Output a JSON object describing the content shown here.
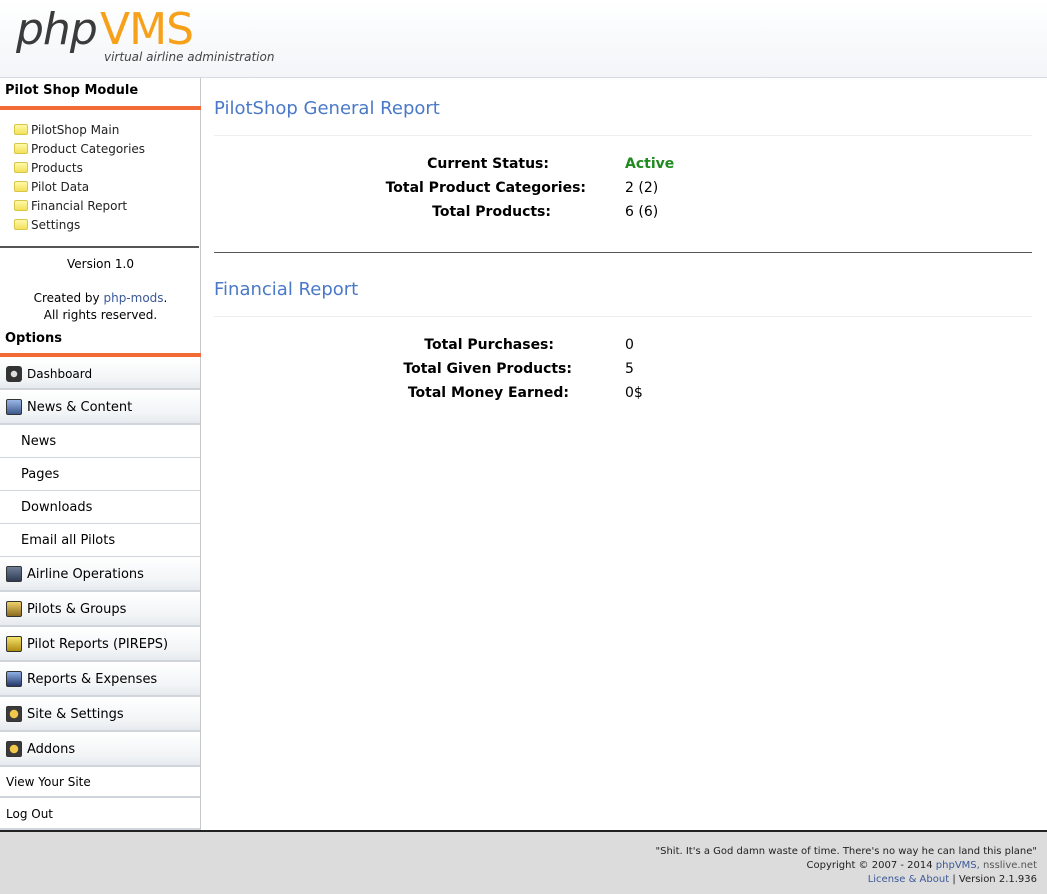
{
  "header": {
    "logo_php": "php",
    "logo_vms": "VMS",
    "tagline": "virtual airline administration"
  },
  "sidebar": {
    "module_title": "Pilot Shop Module",
    "module_items": [
      "PilotShop Main",
      "Product Categories",
      "Products",
      "Pilot Data",
      "Financial Report",
      "Settings"
    ],
    "version": "Version 1.0",
    "created_by": "Created by",
    "created_link": "php-mods",
    "created_end": ".",
    "rights": "All rights reserved.",
    "options_title": "Options",
    "menu": {
      "dashboard": "Dashboard",
      "news_content": "News & Content",
      "news": "News",
      "pages": "Pages",
      "downloads": "Downloads",
      "email_pilots": "Email all Pilots",
      "airline_ops": "Airline Operations",
      "pilots_groups": "Pilots & Groups",
      "pireps": "Pilot Reports (PIREPS)",
      "reports": "Reports & Expenses",
      "site_settings": "Site & Settings",
      "addons": "Addons",
      "view_site": "View Your Site",
      "logout": "Log Out"
    }
  },
  "general": {
    "title": "PilotShop General Report",
    "status_label": "Current Status:",
    "status_value": "Active",
    "categories_label": "Total Product Categories:",
    "categories_value": "2 (2)",
    "products_label": "Total Products:",
    "products_value": "6 (6)"
  },
  "financial": {
    "title": "Financial Report",
    "purchases_label": "Total Purchases:",
    "purchases_value": "0",
    "given_label": "Total Given Products:",
    "given_value": "5",
    "money_label": "Total Money Earned:",
    "money_value": "0$"
  },
  "footer": {
    "quote": "\"Shit. It's a God damn waste of time. There's no way he can land this plane\"",
    "copyright": "Copyright © 2007 - 2014",
    "copyright_link": "phpVMS,",
    "copyright_site": "nsslive.net",
    "license": "License & About",
    "sep": "|",
    "version": "Version 2.1.936"
  },
  "colors": {
    "accent": "#f26a35",
    "link": "#4a79c7",
    "active": "#1f8a1f"
  }
}
